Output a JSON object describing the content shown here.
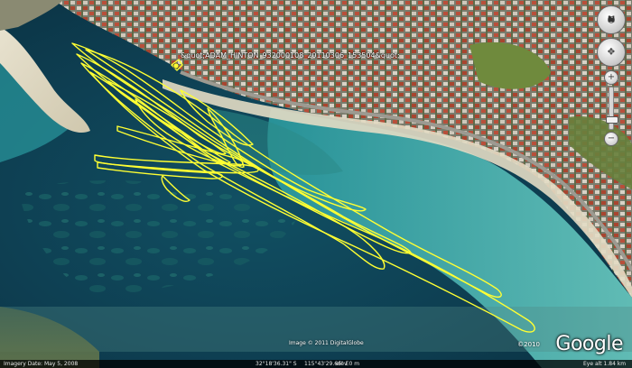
{
  "map": {
    "track_label": "&quot;ADAM_HINTON_932000108_20110306_153504&quot;",
    "track_color": "#ffff33",
    "water_shallow": "#3fb7b4",
    "water_deep": "#0e3c4e",
    "logo": "Google",
    "logo_year": "©2010",
    "image_credit": "Image © 2011 DigitalGlobe"
  },
  "status_bar": {
    "imagery_date": "Imagery Date: May 5, 2008",
    "latitude": "32°18'36.31\" S",
    "longitude": "115°43'29.66\" E",
    "elevation": "elev  0 m",
    "eye_alt": "Eye alt  1.84 km"
  },
  "nav_controls": {
    "north_label": "N",
    "zoom_in": "+",
    "zoom_out": "−"
  }
}
